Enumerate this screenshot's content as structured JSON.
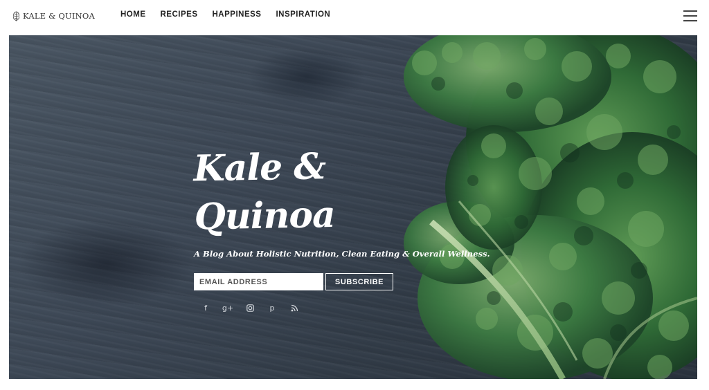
{
  "header": {
    "logo_text": "KALE & QUINOA",
    "nav": [
      {
        "label": "HOME"
      },
      {
        "label": "RECIPES"
      },
      {
        "label": "HAPPINESS"
      },
      {
        "label": "INSPIRATION"
      }
    ],
    "menu_icon": "hamburger-icon"
  },
  "hero": {
    "title": "Kale & Quinoa",
    "tagline": "A Blog About Holistic Nutrition, Clean Eating & Overall Wellness.",
    "email_placeholder": "EMAIL ADDRESS",
    "subscribe_label": "SUBSCRIBE",
    "social": [
      {
        "name": "facebook-icon",
        "glyph": "f"
      },
      {
        "name": "google-plus-icon",
        "glyph": "g+"
      },
      {
        "name": "instagram-icon",
        "glyph": ""
      },
      {
        "name": "pinterest-icon",
        "glyph": "p"
      },
      {
        "name": "rss-icon",
        "glyph": ""
      }
    ]
  },
  "colors": {
    "wood": "#3d4856",
    "kale_dark": "#1f4a2a",
    "kale_light": "#4f8f4a",
    "text_dark": "#222222"
  }
}
